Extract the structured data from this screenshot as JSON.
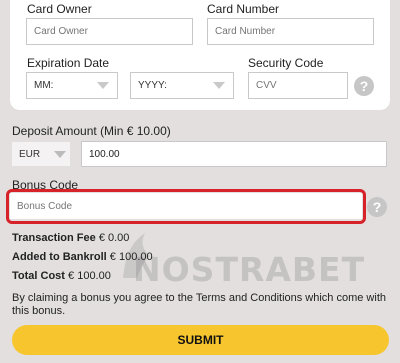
{
  "card": {
    "owner_label": "Card Owner",
    "owner_placeholder": "Card Owner",
    "number_label": "Card Number",
    "number_placeholder": "Card Number",
    "expiration_label": "Expiration Date",
    "month_value": "MM:",
    "year_value": "YYYY:",
    "security_label": "Security Code",
    "cvv_placeholder": "CVV"
  },
  "deposit": {
    "label": "Deposit Amount",
    "min_text": "(Min  € 10.00)",
    "currency": "EUR",
    "amount": "100.00"
  },
  "bonus": {
    "label": "Bonus Code",
    "placeholder": "Bonus Code"
  },
  "summary": {
    "fee_label": "Transaction Fee",
    "fee_value": "€ 0.00",
    "bankroll_label": "Added to Bankroll",
    "bankroll_value": "€ 100.00",
    "total_label": "Total Cost",
    "total_value": "€ 100.00"
  },
  "terms_text": "By claiming a bonus you agree to the  Terms and Conditions  which come with this bonus.",
  "submit_label": "SUBMIT",
  "help_glyph": "?",
  "watermark": "NOSTRABET",
  "colors": {
    "accent": "#f7c62f",
    "highlight": "#d8222a",
    "background": "#e3dfdf"
  }
}
